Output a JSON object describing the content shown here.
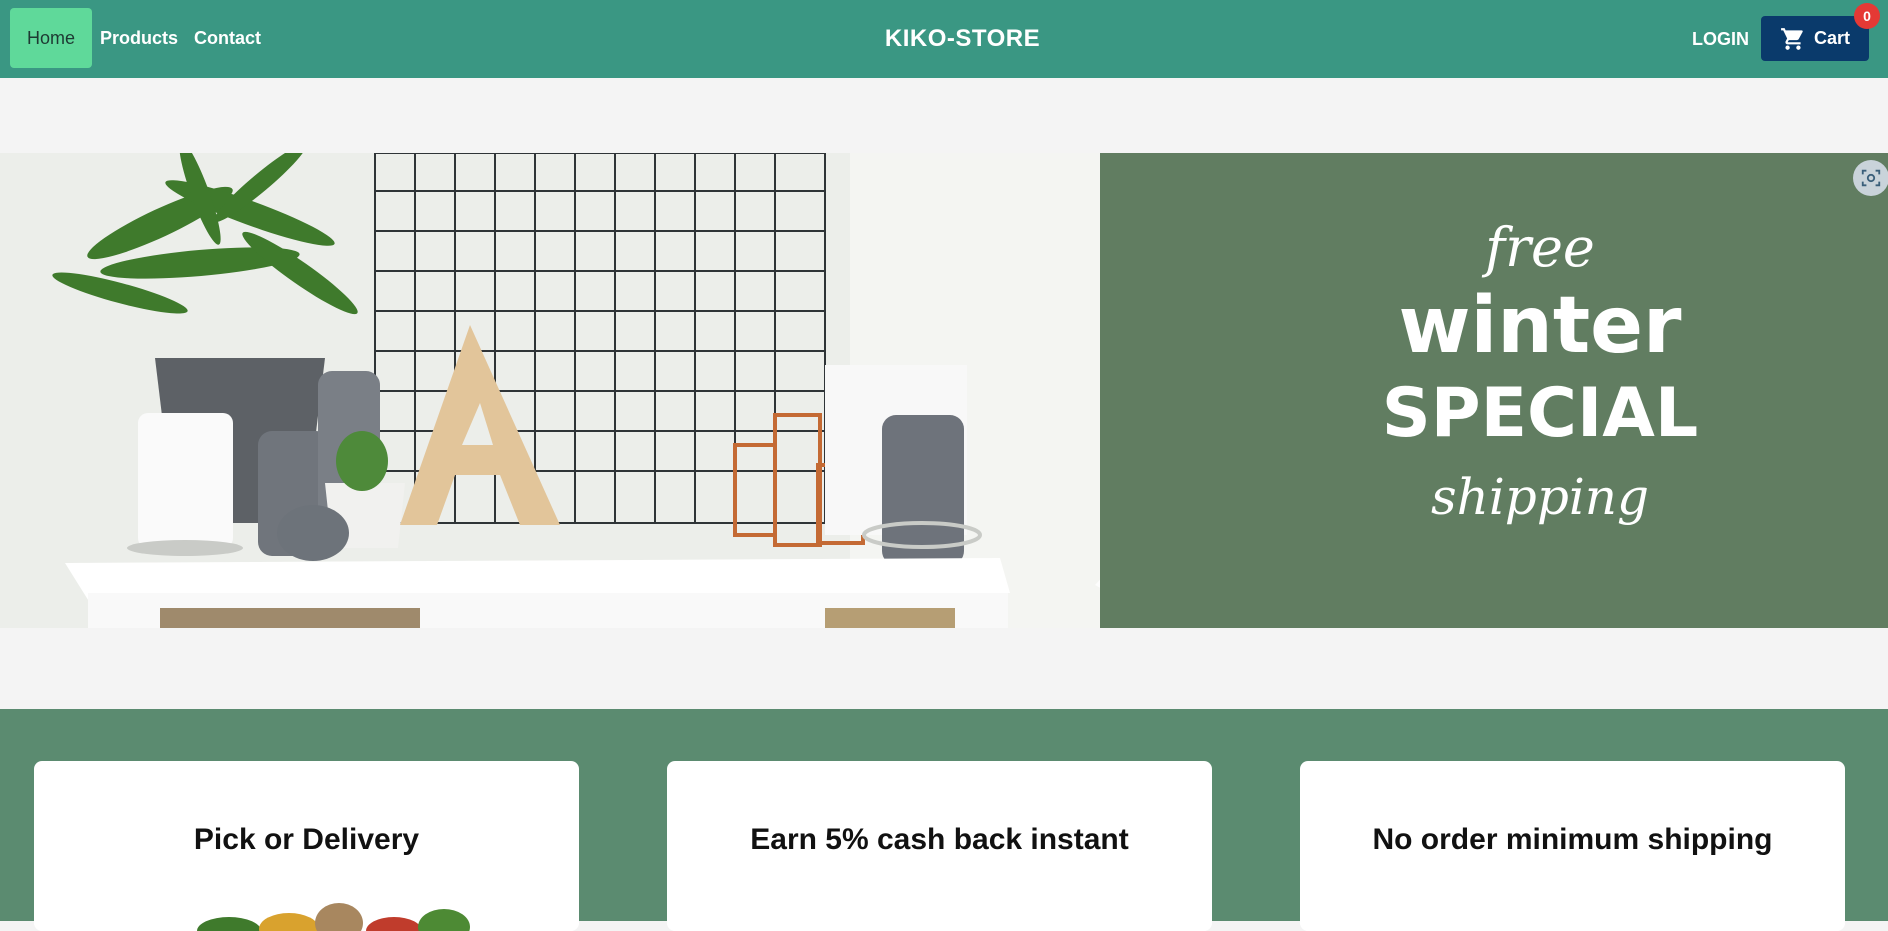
{
  "nav": {
    "links": [
      {
        "label": "Home"
      },
      {
        "label": "Products"
      },
      {
        "label": "Contact"
      }
    ],
    "brand": "KIKO-STORE",
    "login_label": "LOGIN",
    "cart_label": "Cart",
    "cart_count": "0"
  },
  "hero": {
    "promo_line1": "free",
    "promo_line2": "winter",
    "promo_line3": "SPECIAL",
    "promo_line4": "shipping"
  },
  "features": {
    "cards": [
      {
        "title": "Pick or Delivery"
      },
      {
        "title": "Earn 5% cash back instant"
      },
      {
        "title": "No order minimum shipping"
      }
    ]
  },
  "colors": {
    "navbar": "#3a9783",
    "active_link": "#5fd99a",
    "cart_button": "#0a3a6b",
    "badge": "#e53935",
    "promo_panel": "#617d61",
    "features_bg": "#5b8b70"
  }
}
